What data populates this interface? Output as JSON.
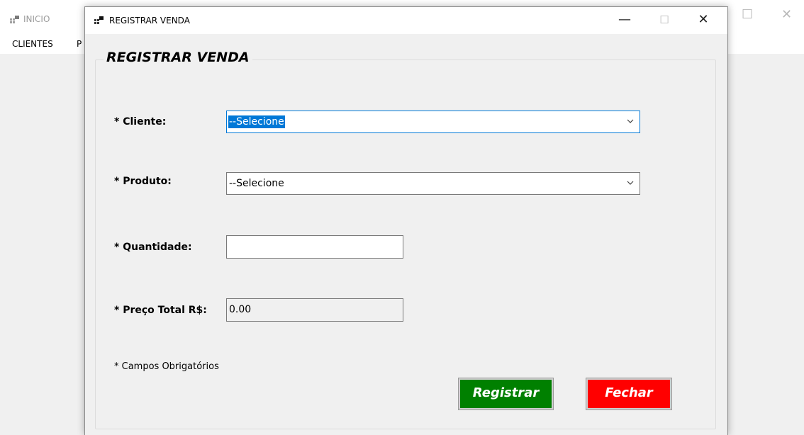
{
  "main_window": {
    "title": "INICIO",
    "menu": [
      "CLIENTES",
      "P"
    ]
  },
  "dialog": {
    "title": "REGISTRAR VENDA",
    "controls": {
      "minimize": "—",
      "maximize": "☐",
      "close": "✕"
    },
    "group_title": "REGISTRAR VENDA",
    "fields": {
      "cliente": {
        "label": "* Cliente:",
        "value": "--Selecione"
      },
      "produto": {
        "label": "* Produto:",
        "value": "--Selecione"
      },
      "quantidade": {
        "label": "* Quantidade:",
        "value": ""
      },
      "preco_total": {
        "label": "* Preço Total R$:",
        "value": "0.00"
      }
    },
    "note": "* Campos Obrigatórios",
    "buttons": {
      "registrar": "Registrar",
      "fechar": "Fechar"
    }
  },
  "colors": {
    "registrar_bg": "#008000",
    "fechar_bg": "#ff0000",
    "focus_accent": "#0078d7"
  }
}
